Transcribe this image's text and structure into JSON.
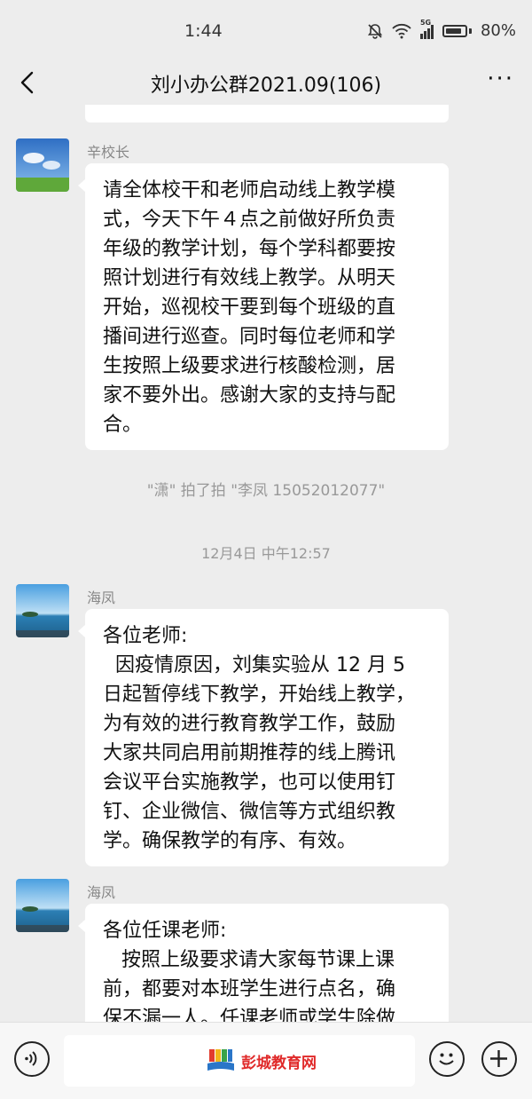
{
  "status": {
    "time": "1:44",
    "network_badge": "5G",
    "battery": "80%"
  },
  "header": {
    "title": "刘小办公群2021.09(106)",
    "more": "···"
  },
  "messages": [
    {
      "sender": "辛校长",
      "lines": [
        "请全体校干和老师启动线上教学模",
        "式，今天下午４点之前做好所负责",
        "年级的教学计划，每个学科都要按",
        "照计划进行有效线上教学。从明天",
        "开始，巡视校干要到每个班级的直",
        "播间进行巡查。同时每位老师和学",
        "生按照上级要求进行核酸检测，居",
        "家不要外出。感谢大家的支持与配",
        "合。"
      ]
    },
    {
      "sender": "海凤",
      "lines": [
        "各位老师:",
        "  因疫情原因，刘集实验从 12 月 5",
        "日起暂停线下教学，开始线上教学，",
        "为有效的进行教育教学工作，鼓励",
        "大家共同启用前期推荐的线上腾讯",
        "会议平台实施教学，也可以使用钉",
        "钉、企业微信、微信等方式组织教",
        "学。确保教学的有序、有效。"
      ]
    },
    {
      "sender": "海凤",
      "lines": [
        "各位任课老师:",
        "   按照上级要求请大家每节课上课",
        "前，都要对本班学生进行点名，确",
        "保不漏一人。任课老师或学生除做"
      ]
    }
  ],
  "system_note": "\"潇\" 拍了拍 \"李凤 15052012077\"",
  "timestamp": "12月4日 中午12:57",
  "input": {
    "watermark": "彭城教育网"
  },
  "colors": {
    "background": "#ededed",
    "bubble": "#ffffff",
    "watermark": "#e02a2a"
  }
}
